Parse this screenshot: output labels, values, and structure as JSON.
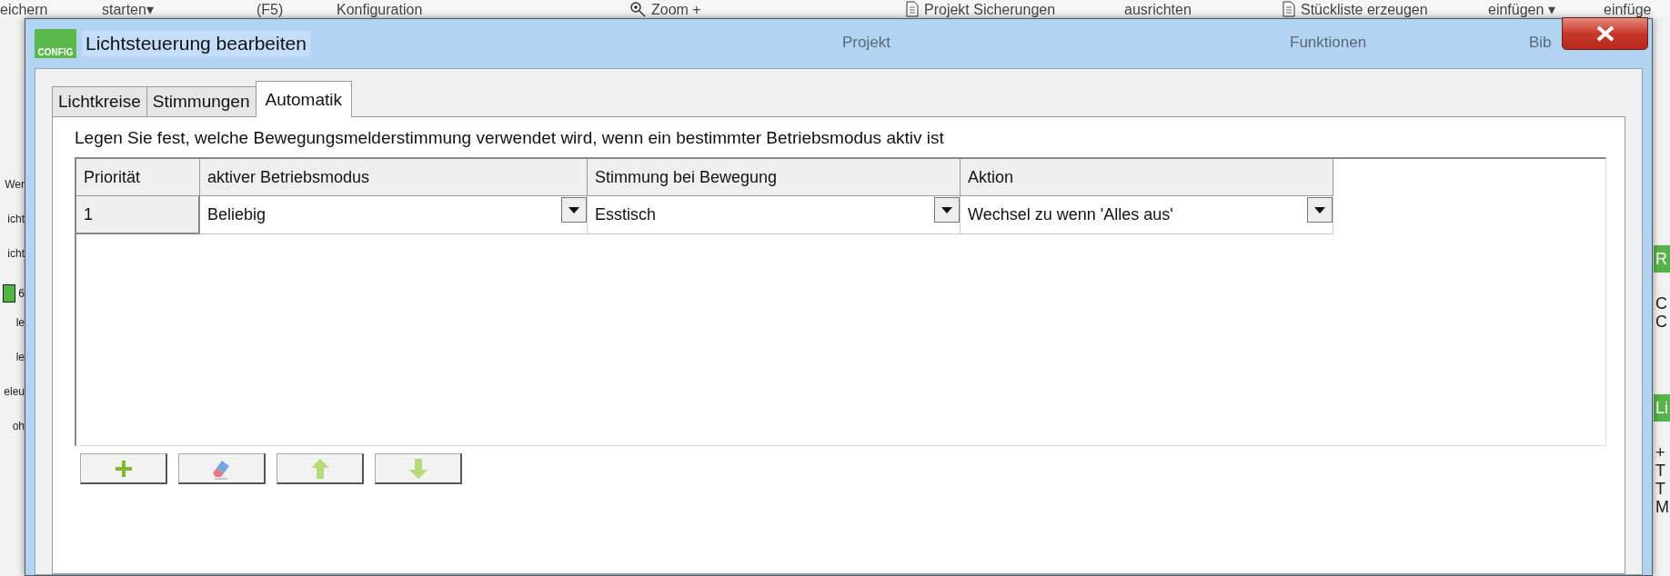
{
  "background_app": {
    "ribbon": [
      "eichern",
      "starten▾",
      "(F5)",
      "Konfiguration",
      "Zoom +",
      "Projekt Sicherungen",
      "ausrichten",
      "Stückliste erzeugen",
      "einfügen ▾",
      "einfüge"
    ],
    "ribbon_groups": [
      "Projekt",
      "Funktionen",
      "Bib"
    ],
    "left_panel": [
      {
        "text": "Wer",
        "kind": "text"
      },
      {
        "text": "icht",
        "kind": "text"
      },
      {
        "text": "icht",
        "kind": "text"
      },
      {
        "text": "6",
        "kind": "checkbox",
        "checked": true
      },
      {
        "text": "le",
        "kind": "text"
      },
      {
        "text": "le",
        "kind": "text"
      },
      {
        "text": "eleu",
        "kind": "text"
      },
      {
        "text": "oh",
        "kind": "text"
      }
    ],
    "right_panel": [
      {
        "text": "R",
        "kind": "header"
      },
      {
        "text": "C",
        "kind": "text"
      },
      {
        "text": "C",
        "kind": "text"
      },
      {
        "text": "Li",
        "kind": "header"
      },
      {
        "text": "+",
        "kind": "text"
      },
      {
        "text": "T",
        "kind": "text"
      },
      {
        "text": "T",
        "kind": "text"
      },
      {
        "text": "M",
        "kind": "text"
      }
    ]
  },
  "dialog": {
    "title": "Lichtsteuerung bearbeiten",
    "icon_label": "CONFIG",
    "tabs": [
      {
        "label": "Lichtkreise",
        "selected": false
      },
      {
        "label": "Stimmungen",
        "selected": false
      },
      {
        "label": "Automatik",
        "selected": true
      }
    ],
    "description": "Legen Sie fest, welche Bewegungsmelderstimmung verwendet wird, wenn ein bestimmter Betriebsmodus aktiv ist",
    "table": {
      "columns": [
        "Priorität",
        "aktiver Betriebsmodus",
        "Stimmung bei Bewegung",
        "Aktion"
      ],
      "rows": [
        {
          "cells": [
            {
              "text": "1",
              "kind": "text"
            },
            {
              "text": "Beliebig",
              "kind": "dropdown"
            },
            {
              "text": "Esstisch",
              "kind": "dropdown"
            },
            {
              "text": "Wechsel zu wenn 'Alles aus'",
              "kind": "dropdown"
            }
          ]
        }
      ]
    },
    "buttons": [
      {
        "kind": "add",
        "disabled": false
      },
      {
        "kind": "erase",
        "disabled": false
      },
      {
        "kind": "up",
        "disabled": true
      },
      {
        "kind": "down",
        "disabled": true
      }
    ]
  }
}
